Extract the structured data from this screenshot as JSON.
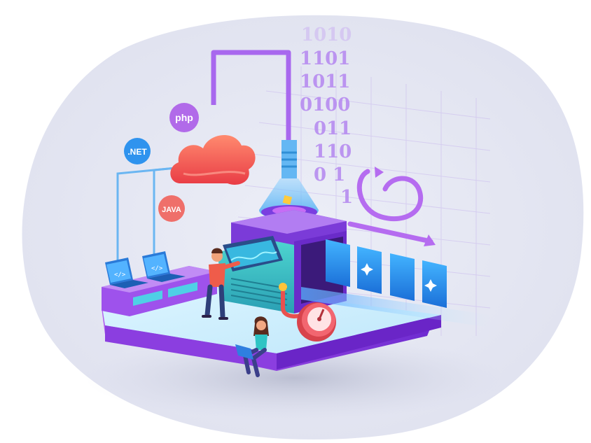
{
  "badges": {
    "php": "php",
    "net": ".NET",
    "java": "JAVA"
  },
  "binary_rows": [
    "1010",
    "1101",
    "1011",
    "0100",
    "011",
    "110",
    "0  1",
    "1"
  ],
  "colors": {
    "backdrop": "#e4e6f1",
    "platform_top": "#cfeefd",
    "platform_side": "#8f3fe0",
    "purple": "#a65ee8",
    "purple_dark": "#6b23c4",
    "teal": "#3ec4c9",
    "cloud": "#f0584d",
    "gauge": "#f15863",
    "card_blue": "#2a92ee",
    "pipe_blue": "#67b8f2"
  },
  "icons": [
    "cloud-icon",
    "flask-icon",
    "gauge-icon",
    "cycle-arrow-icon",
    "laptop-icon",
    "sparkle-icon"
  ]
}
